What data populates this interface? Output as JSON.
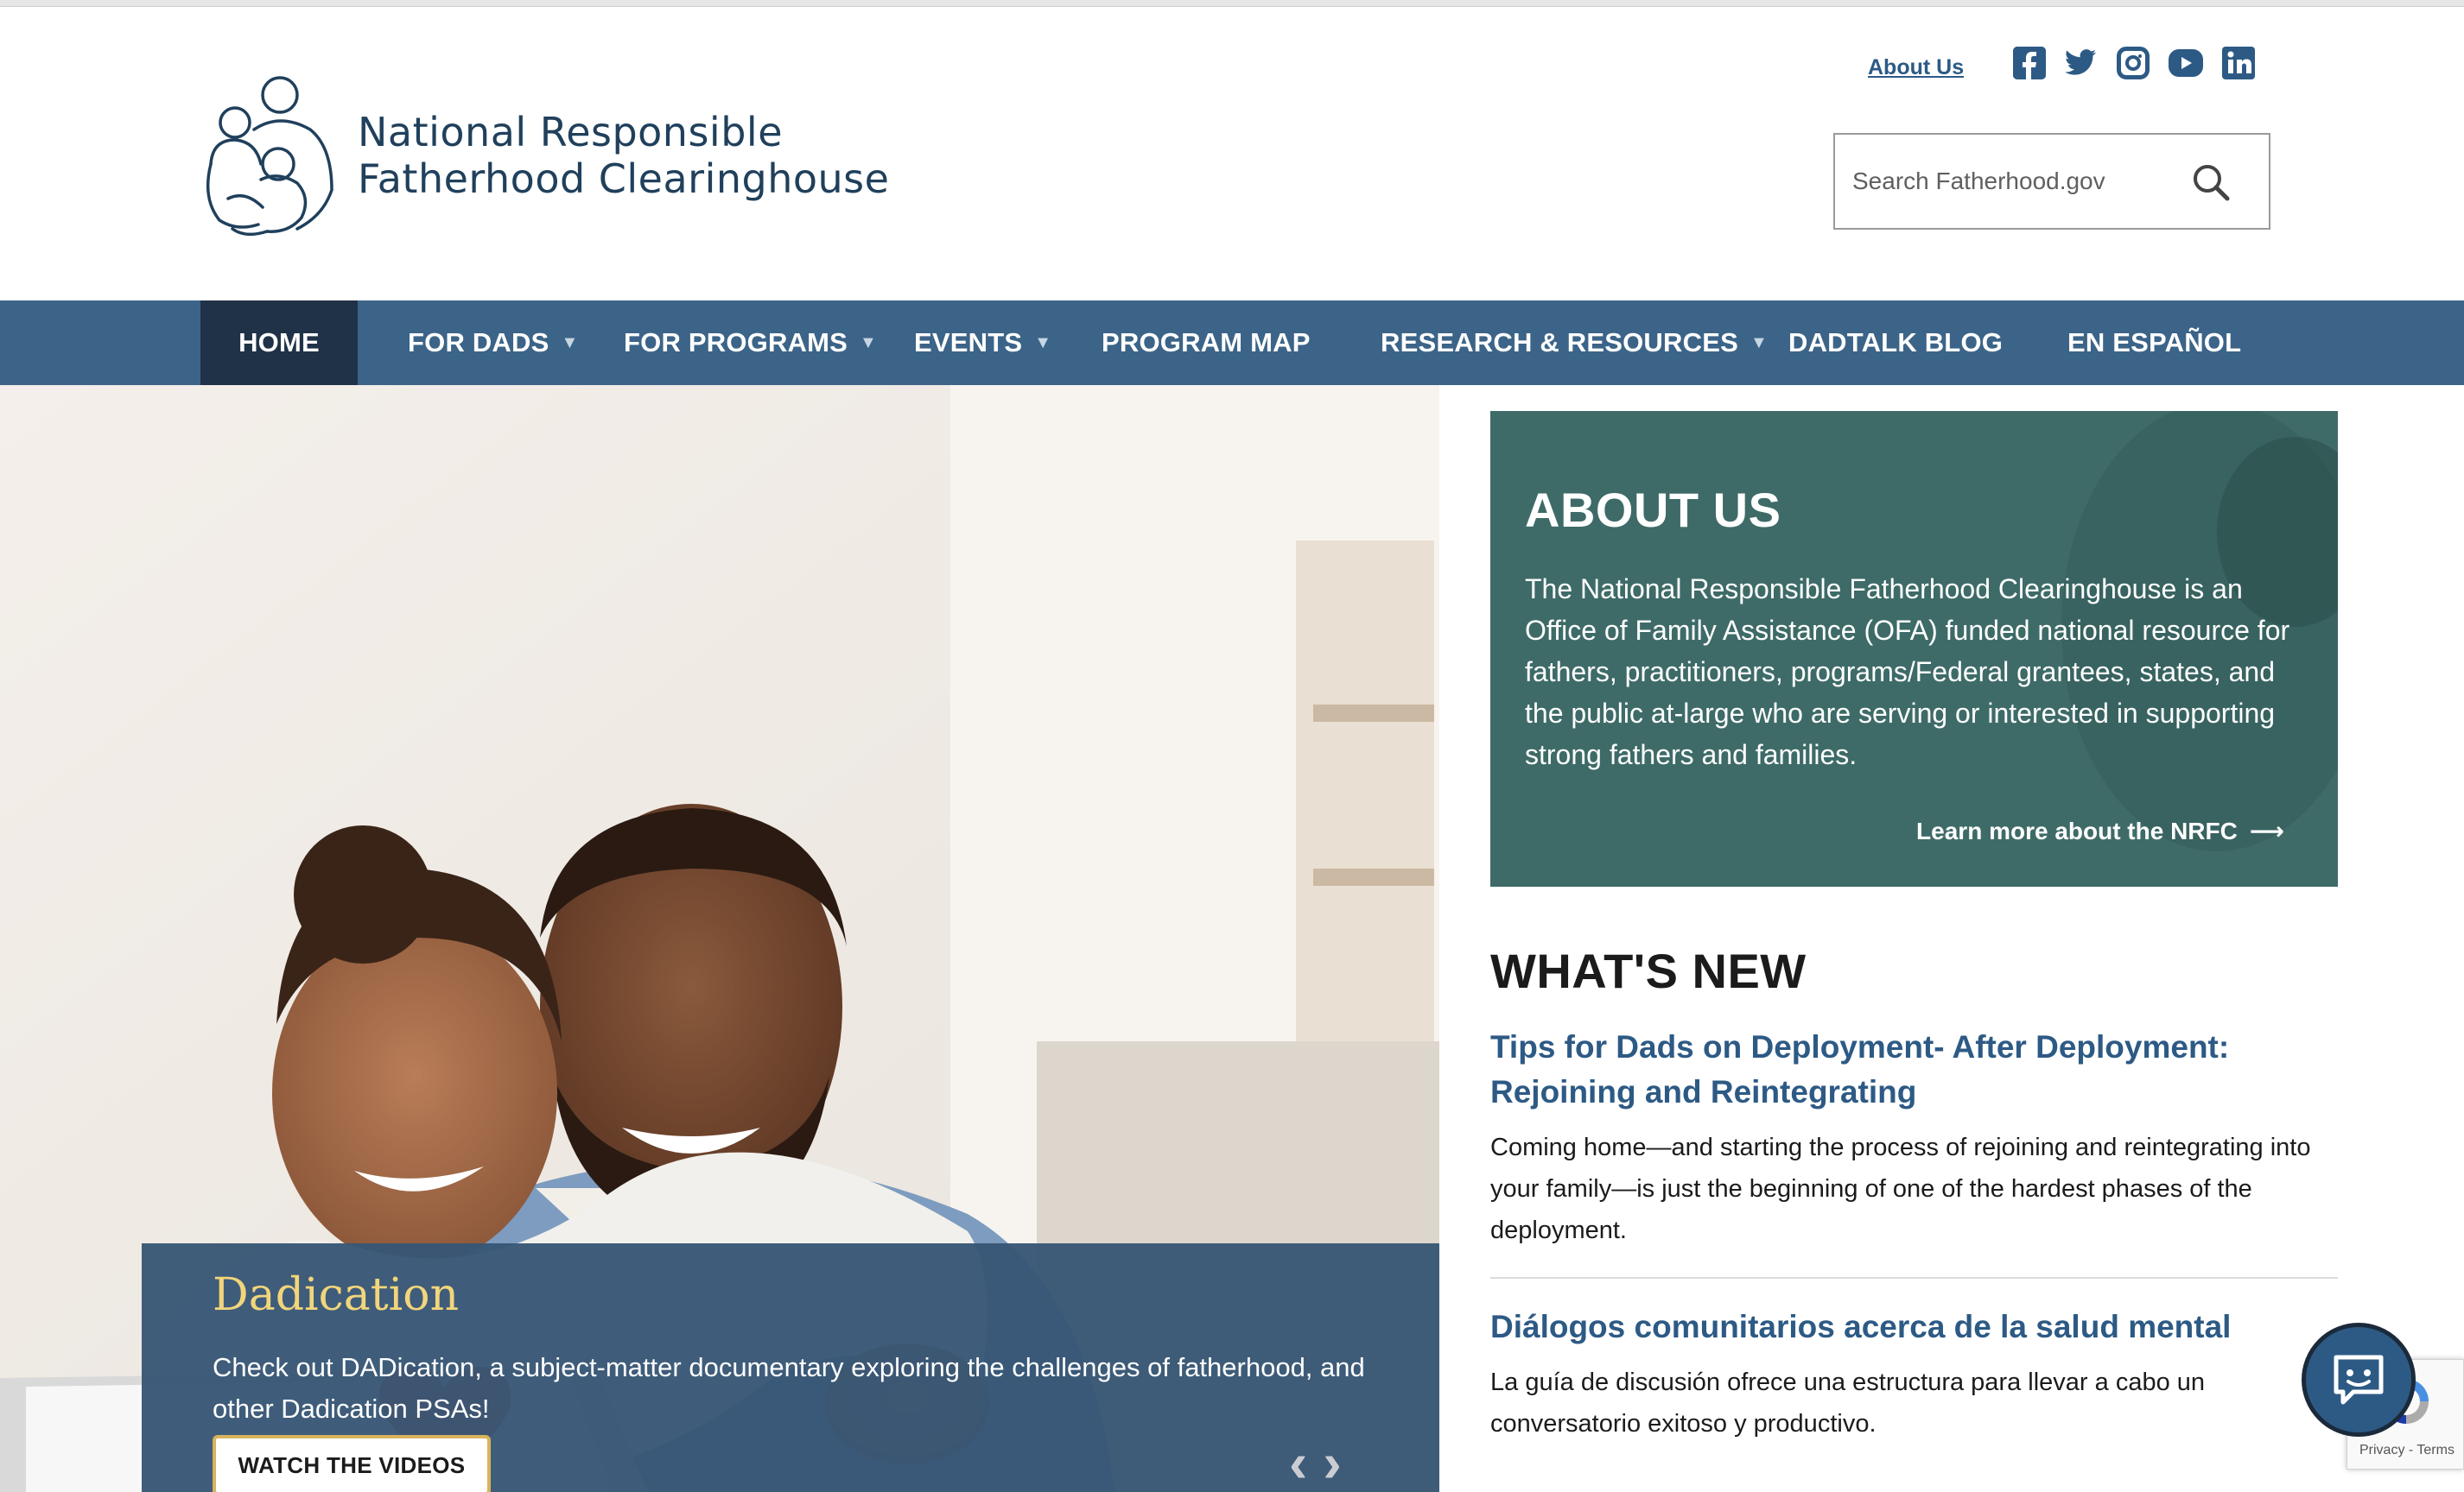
{
  "header": {
    "logo_line1": "National Responsible",
    "logo_line2": "Fatherhood Clearinghouse",
    "about_link": "About Us",
    "social_icons": [
      "facebook-icon",
      "twitter-icon",
      "instagram-icon",
      "youtube-icon",
      "linkedin-icon"
    ],
    "search_placeholder": "Search Fatherhood.gov"
  },
  "nav": {
    "items": [
      {
        "label": "HOME",
        "dropdown": false,
        "active": true
      },
      {
        "label": "FOR DADS",
        "dropdown": true
      },
      {
        "label": "FOR PROGRAMS",
        "dropdown": true
      },
      {
        "label": "EVENTS",
        "dropdown": true
      },
      {
        "label": "PROGRAM MAP",
        "dropdown": false
      },
      {
        "label": "RESEARCH & RESOURCES",
        "dropdown": true
      },
      {
        "label": "DADTALK BLOG",
        "dropdown": false
      },
      {
        "label": "EN ESPAÑOL",
        "dropdown": false
      }
    ],
    "caret": "▼"
  },
  "hero": {
    "title": "Dadication",
    "text": "Check out DADication, a subject-matter documentary exploring the challenges of fatherhood, and other Dadication PSAs!",
    "button": "WATCH THE VIDEOS",
    "prev": "‹",
    "next": "›"
  },
  "about": {
    "heading": "ABOUT US",
    "text": "The National Responsible Fatherhood Clearinghouse is an Office of Family Assistance (OFA) funded national resource for fathers, practitioners, programs/Federal grantees, states, and the public at-large who are serving or interested in supporting strong fathers and families.",
    "link": "Learn more about the NRFC",
    "arrow": "⟶"
  },
  "whats_new": {
    "heading": "WHAT'S NEW",
    "items": [
      {
        "title": "Tips for Dads on Deployment- After Deployment: Rejoining and Reintegrating",
        "text": "Coming home—and starting the process of rejoining and reintegrating into your family—is just the beginning of one of the hardest phases of the deployment."
      },
      {
        "title": "Diálogos comunitarios acerca de la salud mental",
        "text": "La guía de discusión ofrece una estructura para llevar a cabo un conversatorio exitoso y productivo."
      }
    ]
  },
  "recaptcha": {
    "text": "Privacy - Terms"
  },
  "colors": {
    "nav_bg": "#3c6488",
    "nav_active": "#1f3247",
    "link_blue": "#2d5a85",
    "about_bg": "#3e6b68",
    "caption_title": "#f2d57b"
  }
}
